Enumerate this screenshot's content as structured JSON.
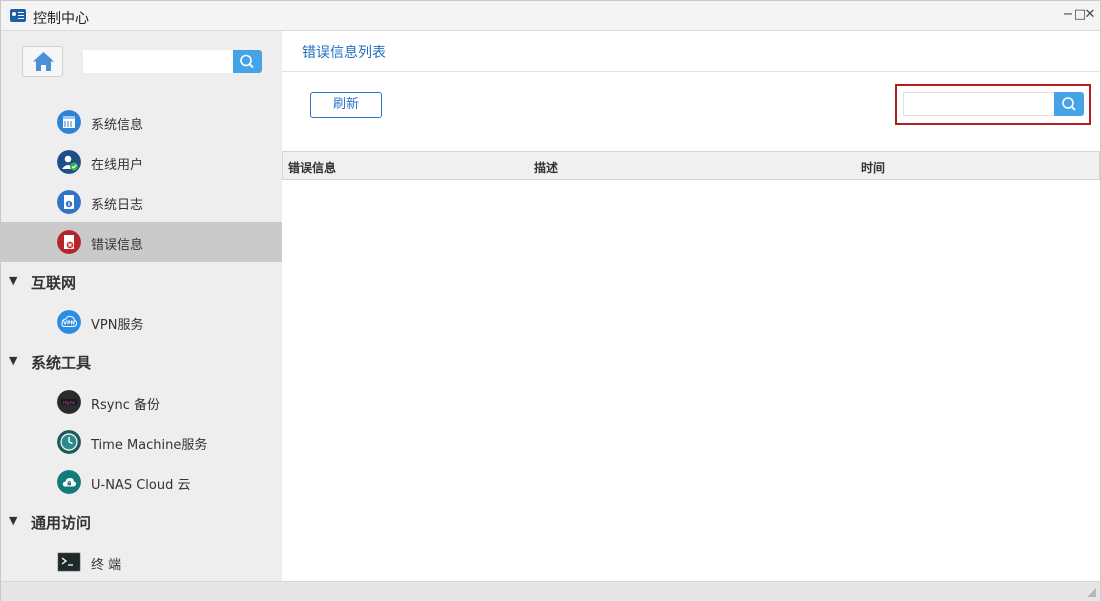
{
  "window": {
    "title": "控制中心"
  },
  "sidebar": {
    "search_placeholder": "",
    "items": [
      {
        "label": "系统信息",
        "icon": "system-info-icon"
      },
      {
        "label": "在线用户",
        "icon": "online-users-icon"
      },
      {
        "label": "系统日志",
        "icon": "system-log-icon"
      },
      {
        "label": "错误信息",
        "icon": "error-info-icon",
        "active": true
      }
    ],
    "groups": [
      {
        "label": "互联网",
        "items": [
          {
            "label": "VPN服务",
            "icon": "vpn-icon"
          }
        ]
      },
      {
        "label": "系统工具",
        "items": [
          {
            "label": "Rsync 备份",
            "icon": "rsync-icon",
            "icon_text": "rsync"
          },
          {
            "label": "Time Machine服务",
            "icon": "time-machine-icon"
          },
          {
            "label": "U-NAS Cloud 云",
            "icon": "cloud-icon"
          }
        ]
      },
      {
        "label": "通用访问",
        "items": [
          {
            "label": "终 端",
            "icon": "terminal-icon"
          }
        ]
      }
    ]
  },
  "main": {
    "title": "错误信息列表",
    "refresh_label": "刷新",
    "search_placeholder": "",
    "table": {
      "columns": [
        "错误信息",
        "描述",
        "时间"
      ],
      "rows": []
    }
  },
  "colors": {
    "accent": "#45a4e6",
    "link": "#1e6fc0",
    "highlight": "#b21e1e",
    "active_row": "#cacaca",
    "sidebar_bg": "#eeeeee"
  }
}
